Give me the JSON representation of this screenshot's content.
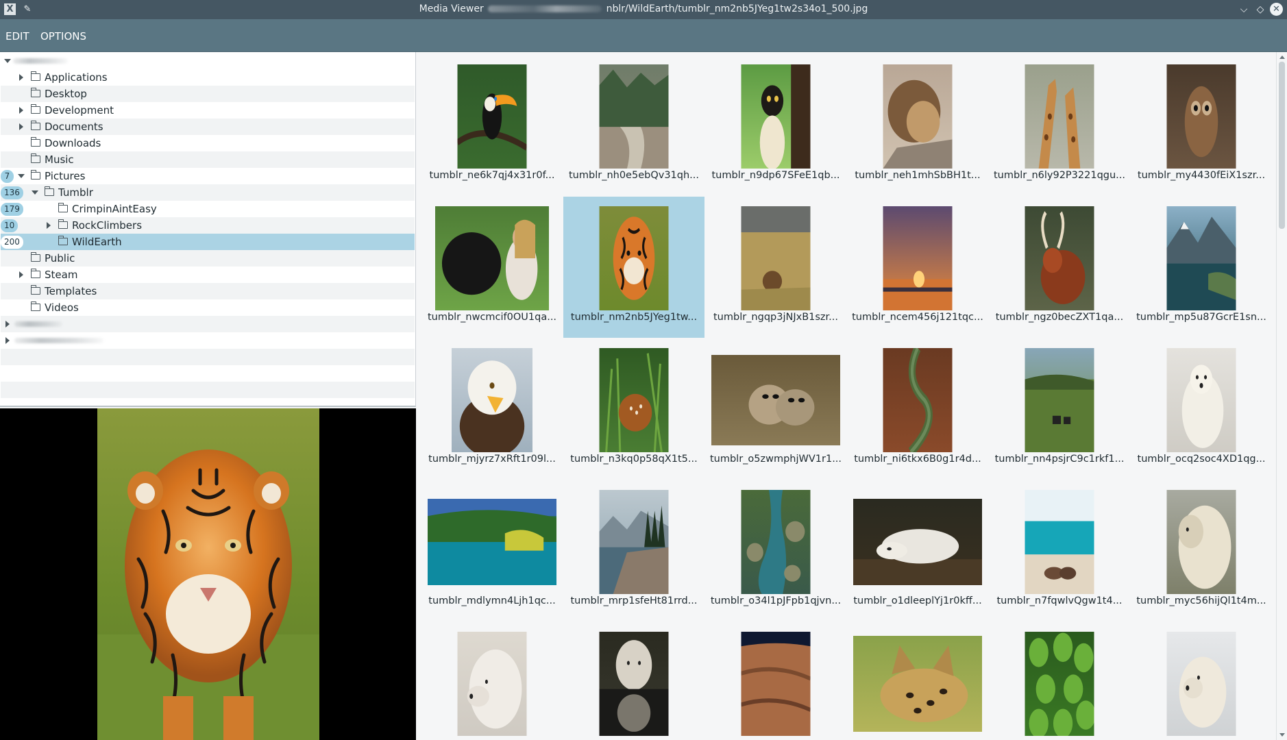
{
  "window": {
    "title_prefix": "Media Viewer",
    "title_suffix": "nblr/WildEarth/tumblr_nm2nb5JYeg1tw2s34o1_500.jpg",
    "app_icon": "x-window-icon",
    "pin_icon": "pin-icon",
    "minimize_symbol": "⌵",
    "maximize_symbol": "◇",
    "close_symbol": "✕"
  },
  "menu": {
    "items": [
      "EDIT",
      "OPTIONS"
    ]
  },
  "tree": {
    "rows": [
      {
        "label": "Applications",
        "expander": "collapsed",
        "badge": ""
      },
      {
        "label": "Desktop",
        "expander": "none",
        "badge": ""
      },
      {
        "label": "Development",
        "expander": "collapsed",
        "badge": ""
      },
      {
        "label": "Documents",
        "expander": "collapsed",
        "badge": ""
      },
      {
        "label": "Downloads",
        "expander": "none",
        "badge": ""
      },
      {
        "label": "Music",
        "expander": "none",
        "badge": ""
      },
      {
        "label": "Pictures",
        "expander": "expanded",
        "badge": "7"
      },
      {
        "label": "Tumblr",
        "expander": "expanded",
        "badge": "136"
      },
      {
        "label": "CrimpinAintEasy",
        "expander": "none",
        "badge": "179"
      },
      {
        "label": "RockClimbers",
        "expander": "collapsed",
        "badge": "10"
      },
      {
        "label": "WildEarth",
        "expander": "none",
        "badge": "200",
        "selected": true
      },
      {
        "label": "Public",
        "expander": "none",
        "badge": ""
      },
      {
        "label": "Steam",
        "expander": "collapsed",
        "badge": ""
      },
      {
        "label": "Templates",
        "expander": "none",
        "badge": ""
      },
      {
        "label": "Videos",
        "expander": "none",
        "badge": ""
      }
    ]
  },
  "preview": {
    "subject": "tiger"
  },
  "grid": {
    "items": [
      {
        "caption": "tumblr_ne6k7qj4x31r0f...",
        "subject": "toucan"
      },
      {
        "caption": "tumblr_nh0e5ebQv31qh...",
        "subject": "forest-river"
      },
      {
        "caption": "tumblr_n9dp67SFeE1qb...",
        "subject": "lemur"
      },
      {
        "caption": "tumblr_neh1mhSbBH1t...",
        "subject": "lion-sleeping"
      },
      {
        "caption": "tumblr_n6ly92P3221qgu...",
        "subject": "giraffes"
      },
      {
        "caption": "tumblr_my4430fEiX1szr...",
        "subject": "owl"
      },
      {
        "caption": "tumblr_nwcmcif0OU1qa...",
        "subject": "dog-high-five"
      },
      {
        "caption": "tumblr_nm2nb5JYeg1tw...",
        "subject": "tiger",
        "selected": true
      },
      {
        "caption": "tumblr_ngqp3jNJxB1szr...",
        "subject": "lion-grass"
      },
      {
        "caption": "tumblr_ncem456j121tqc...",
        "subject": "sunset"
      },
      {
        "caption": "tumblr_ngz0becZXT1qa...",
        "subject": "antelope"
      },
      {
        "caption": "tumblr_mp5u87GcrE1sn...",
        "subject": "mountain-lake"
      },
      {
        "caption": "tumblr_mjyrz7xRft1r09l...",
        "subject": "eagle"
      },
      {
        "caption": "tumblr_n3kq0p58qX1t5...",
        "subject": "fawn"
      },
      {
        "caption": "tumblr_o5zwmphjWV1r1...",
        "subject": "meerkats"
      },
      {
        "caption": "tumblr_ni6tkx6B0g1r4d...",
        "subject": "canyon-river"
      },
      {
        "caption": "tumblr_nn4psjrC9c1rkf1...",
        "subject": "zebras"
      },
      {
        "caption": "tumblr_ocq2soc4XD1qg...",
        "subject": "polar-bear"
      },
      {
        "caption": "tumblr_mdlymn4Ljh1qc...",
        "subject": "turquoise-lake"
      },
      {
        "caption": "tumblr_mrp1sfeHt81rrd...",
        "subject": "rocky-shore"
      },
      {
        "caption": "tumblr_o34l1pJFpb1qjvn...",
        "subject": "stream-rocks"
      },
      {
        "caption": "tumblr_o1dleeplYj1r0kff...",
        "subject": "white-wolf"
      },
      {
        "caption": "tumblr_n7fqwlvQgw1t4...",
        "subject": "beach-seals"
      },
      {
        "caption": "tumblr_myc56hijQl1t4m...",
        "subject": "bears-hugging"
      },
      {
        "caption": "",
        "subject": "wolf-profile"
      },
      {
        "caption": "",
        "subject": "wolf-reflection"
      },
      {
        "caption": "",
        "subject": "desert-from-space"
      },
      {
        "caption": "",
        "subject": "serval"
      },
      {
        "caption": "",
        "subject": "treetops"
      },
      {
        "caption": "",
        "subject": "snow-wolf"
      }
    ]
  },
  "colors": {
    "titlebar": "#455763",
    "menubar": "#5a7683",
    "selection": "#abd3e4",
    "badge": "#9fd0e4"
  }
}
